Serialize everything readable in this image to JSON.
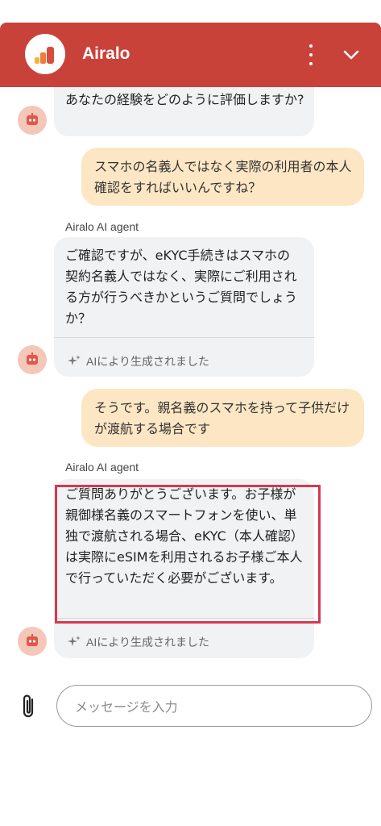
{
  "header": {
    "title": "Airalo"
  },
  "messages": {
    "bot1": {
      "text": "あなたの経験をどのように評価しますか?"
    },
    "user1": {
      "text": "スマホの名義人ではなく実際の利用者の本人確認をすればいいんですね？"
    },
    "bot2": {
      "sender": "Airalo AI agent",
      "text": "ご確認ですが、eKYC手続きはスマホの契約名義人ではなく、実際にご利用される方が行うべきかというご質問でしょうか？",
      "ai_note": "AIにより生成されました"
    },
    "user2": {
      "text": "そうです。親名義のスマホを持って子供だけが渡航する場合です"
    },
    "bot3": {
      "sender": "Airalo AI agent",
      "text": "ご質問ありがとうございます。お子様が親御様名義のスマートフォンを使い、単独で渡航される場合、eKYC（本人確認）は実際にeSIMを利用されるお子様ご本人で行っていただく必要がございます。",
      "ai_note": "AIにより生成されました"
    }
  },
  "composer": {
    "placeholder": "メッセージを入力"
  },
  "colors": {
    "header": "#c9423a",
    "user_bubble": "#fde6c4",
    "bot_bubble": "#f1f2f4",
    "highlight": "#d6394f"
  }
}
